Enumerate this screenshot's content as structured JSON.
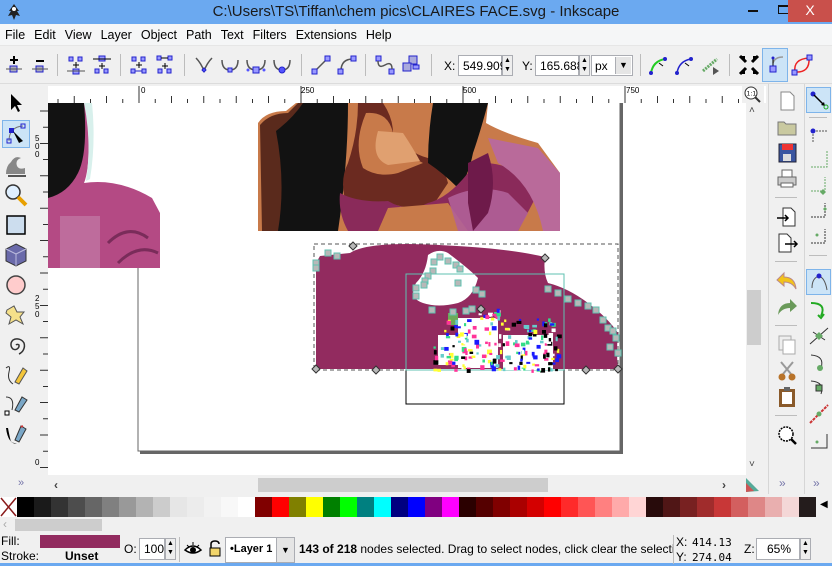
{
  "window": {
    "title": "C:\\Users\\TS\\Tiffan\\chem pics\\CLAIRES FACE.svg - Inkscape",
    "minimize": "–",
    "maximize": "□",
    "close": "X"
  },
  "menu": [
    "File",
    "Edit",
    "View",
    "Layer",
    "Object",
    "Path",
    "Text",
    "Filters",
    "Extensions",
    "Help"
  ],
  "toolcontrols": {
    "buttons": [
      "insert-node",
      "delete-node",
      "join-nodes",
      "break-path",
      "join-segment",
      "delete-segment",
      "make-cusp",
      "make-smooth",
      "make-symmetric",
      "auto-smooth",
      "make-line",
      "make-curve",
      "object-to-path",
      "stroke-to-path"
    ],
    "x_label": "X:",
    "x_value": "549.909",
    "y_label": "Y:",
    "y_value": "165.688",
    "unit": "px",
    "right_buttons": [
      "next-path-effect-param",
      "clippath",
      "mask",
      "transform-handles",
      "show-handles",
      "path-outline"
    ]
  },
  "toolbox": [
    "selector",
    "node-editor",
    "tweak",
    "zoom",
    "rectangle",
    "3d-box",
    "ellipse",
    "star",
    "spiral",
    "pencil",
    "pen",
    "calligraphy"
  ],
  "ruler": {
    "h_labels": [
      "0",
      "250",
      "500",
      "750"
    ],
    "v_labels": [
      "500",
      "250",
      "0"
    ]
  },
  "commands": [
    "new",
    "open",
    "save",
    "print",
    "import",
    "export",
    "undo",
    "redo",
    "duplicate",
    "cut",
    "paste",
    "zoom-drawing"
  ],
  "snap": [
    "snap-toggle",
    "snap-bbox",
    "snap-bbox-edge",
    "snap-bbox-corner",
    "snap-bbox-midpoint",
    "snap-bbox-center",
    "snap-nodes",
    "snap-paths",
    "snap-path-intersections",
    "snap-cusp",
    "snap-smooth",
    "snap-midpoint",
    "snap-page"
  ],
  "palette": {
    "colors": [
      "#000000",
      "#1a1a1a",
      "#333333",
      "#4d4d4d",
      "#666666",
      "#808080",
      "#999999",
      "#b3b3b3",
      "#cccccc",
      "#e6e6e6",
      "#ececec",
      "#f2f2f2",
      "#f8f8f8",
      "#ffffff",
      "#800000",
      "#ff0000",
      "#808000",
      "#ffff00",
      "#008000",
      "#00ff00",
      "#008080",
      "#00ffff",
      "#000080",
      "#0000ff",
      "#800080",
      "#ff00ff",
      "#2b0000",
      "#550000",
      "#800000",
      "#aa0000",
      "#d40000",
      "#ff0000",
      "#ff2a2a",
      "#ff5555",
      "#ff8080",
      "#ffaaaa",
      "#ffd5d5",
      "#280b0b",
      "#501616",
      "#782121",
      "#a02c2c",
      "#c83737",
      "#d35f5f",
      "#de8787",
      "#e9afaf",
      "#f4d7d7",
      "#241c1c"
    ]
  },
  "status": {
    "fill_label": "Fill:",
    "fill_color": "#922b5f",
    "stroke_label": "Stroke:",
    "stroke_value": "Unset",
    "opacity_label": "O:",
    "opacity_value": "100",
    "layer": "•Layer 1",
    "message_bold": "143 of 218",
    "message": " nodes selected. Drag to select nodes, click clear the selectio",
    "cursor_x_label": "X:",
    "cursor_x": "414.13",
    "cursor_y_label": "Y:",
    "cursor_y": "274.04",
    "zoom_label": "Z:",
    "zoom_value": "65%"
  },
  "colors": {
    "titlebar": "#6ba9f0",
    "close": "#c9504b",
    "shape_fill": "#922b5f",
    "active_tool": "#cce4f7"
  }
}
